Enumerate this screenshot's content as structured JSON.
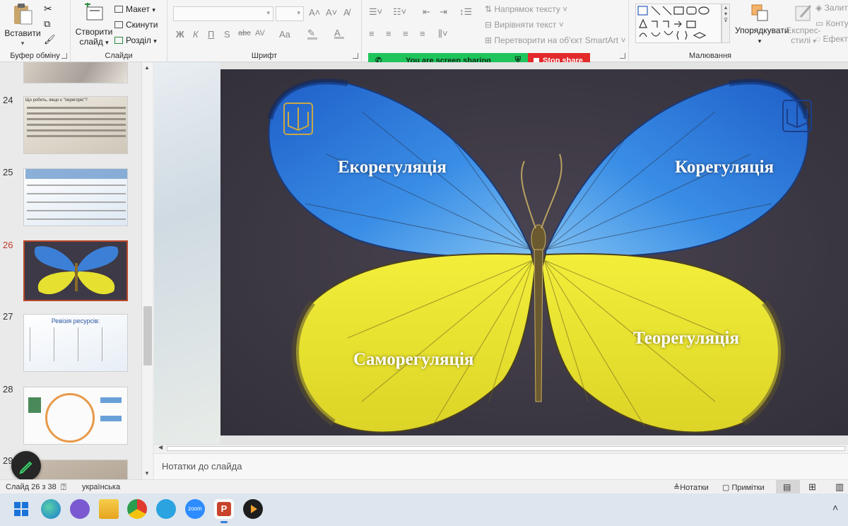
{
  "ribbon": {
    "clipboard": {
      "paste": "Вставити",
      "group_label": "Буфер обміну"
    },
    "slides": {
      "new_slide_line1": "Створити",
      "new_slide_line2": "слайд",
      "layout": "Макет",
      "reset": "Скинути",
      "section": "Розділ",
      "group_label": "Слайди"
    },
    "font": {
      "bold": "Ж",
      "italic": "К",
      "underline": "П",
      "shadow": "S",
      "strike": "abc",
      "spacing": "AV",
      "case": "Aa",
      "grow": "A",
      "shrink": "A",
      "group_label": "Шрифт"
    },
    "paragraph": {
      "text_direction": "Напрямок тексту",
      "align_text": "Вирівняти текст",
      "convert_smartart": "Перетворити на об'єкт SmartArt"
    },
    "drawing": {
      "arrange": "Упорядкувати",
      "quick_styles_line1": "Експрес-",
      "quick_styles_line2": "стилі",
      "fill": "Залит",
      "outline": "Конту",
      "effects": "Ефект",
      "group_label": "Малювання"
    }
  },
  "share_bar": {
    "status": "You are screen sharing",
    "stop": "Stop share"
  },
  "thumbnails": [
    {
      "number": "24",
      "title": "Що робить, якщо є \"перегоріє\"?"
    },
    {
      "number": "25",
      "title": ""
    },
    {
      "number": "26",
      "title": "",
      "active": true
    },
    {
      "number": "27",
      "title": "Ревізія ресурсів:"
    },
    {
      "number": "28",
      "title": ""
    },
    {
      "number": "29",
      "title": ""
    }
  ],
  "slide": {
    "label_top_left": "Екорегуляція",
    "label_top_right": "Корегуляція",
    "label_bottom_left": "Саморегуляція",
    "label_bottom_right": "Теорегуляція"
  },
  "notes": {
    "placeholder": "Нотатки до слайда"
  },
  "status": {
    "slide_counter": "Слайд 26 з 38",
    "language": "українська",
    "notes_btn": "Нотатки",
    "comments_btn": "Примітки"
  },
  "taskbar": {
    "apps": [
      "start-icon",
      "edge-icon",
      "viber-icon",
      "explorer-icon",
      "chrome-icon",
      "telegram-icon",
      "zoom-icon",
      "powerpoint-icon",
      "media-player-icon"
    ],
    "zoom_label": "zoom"
  }
}
